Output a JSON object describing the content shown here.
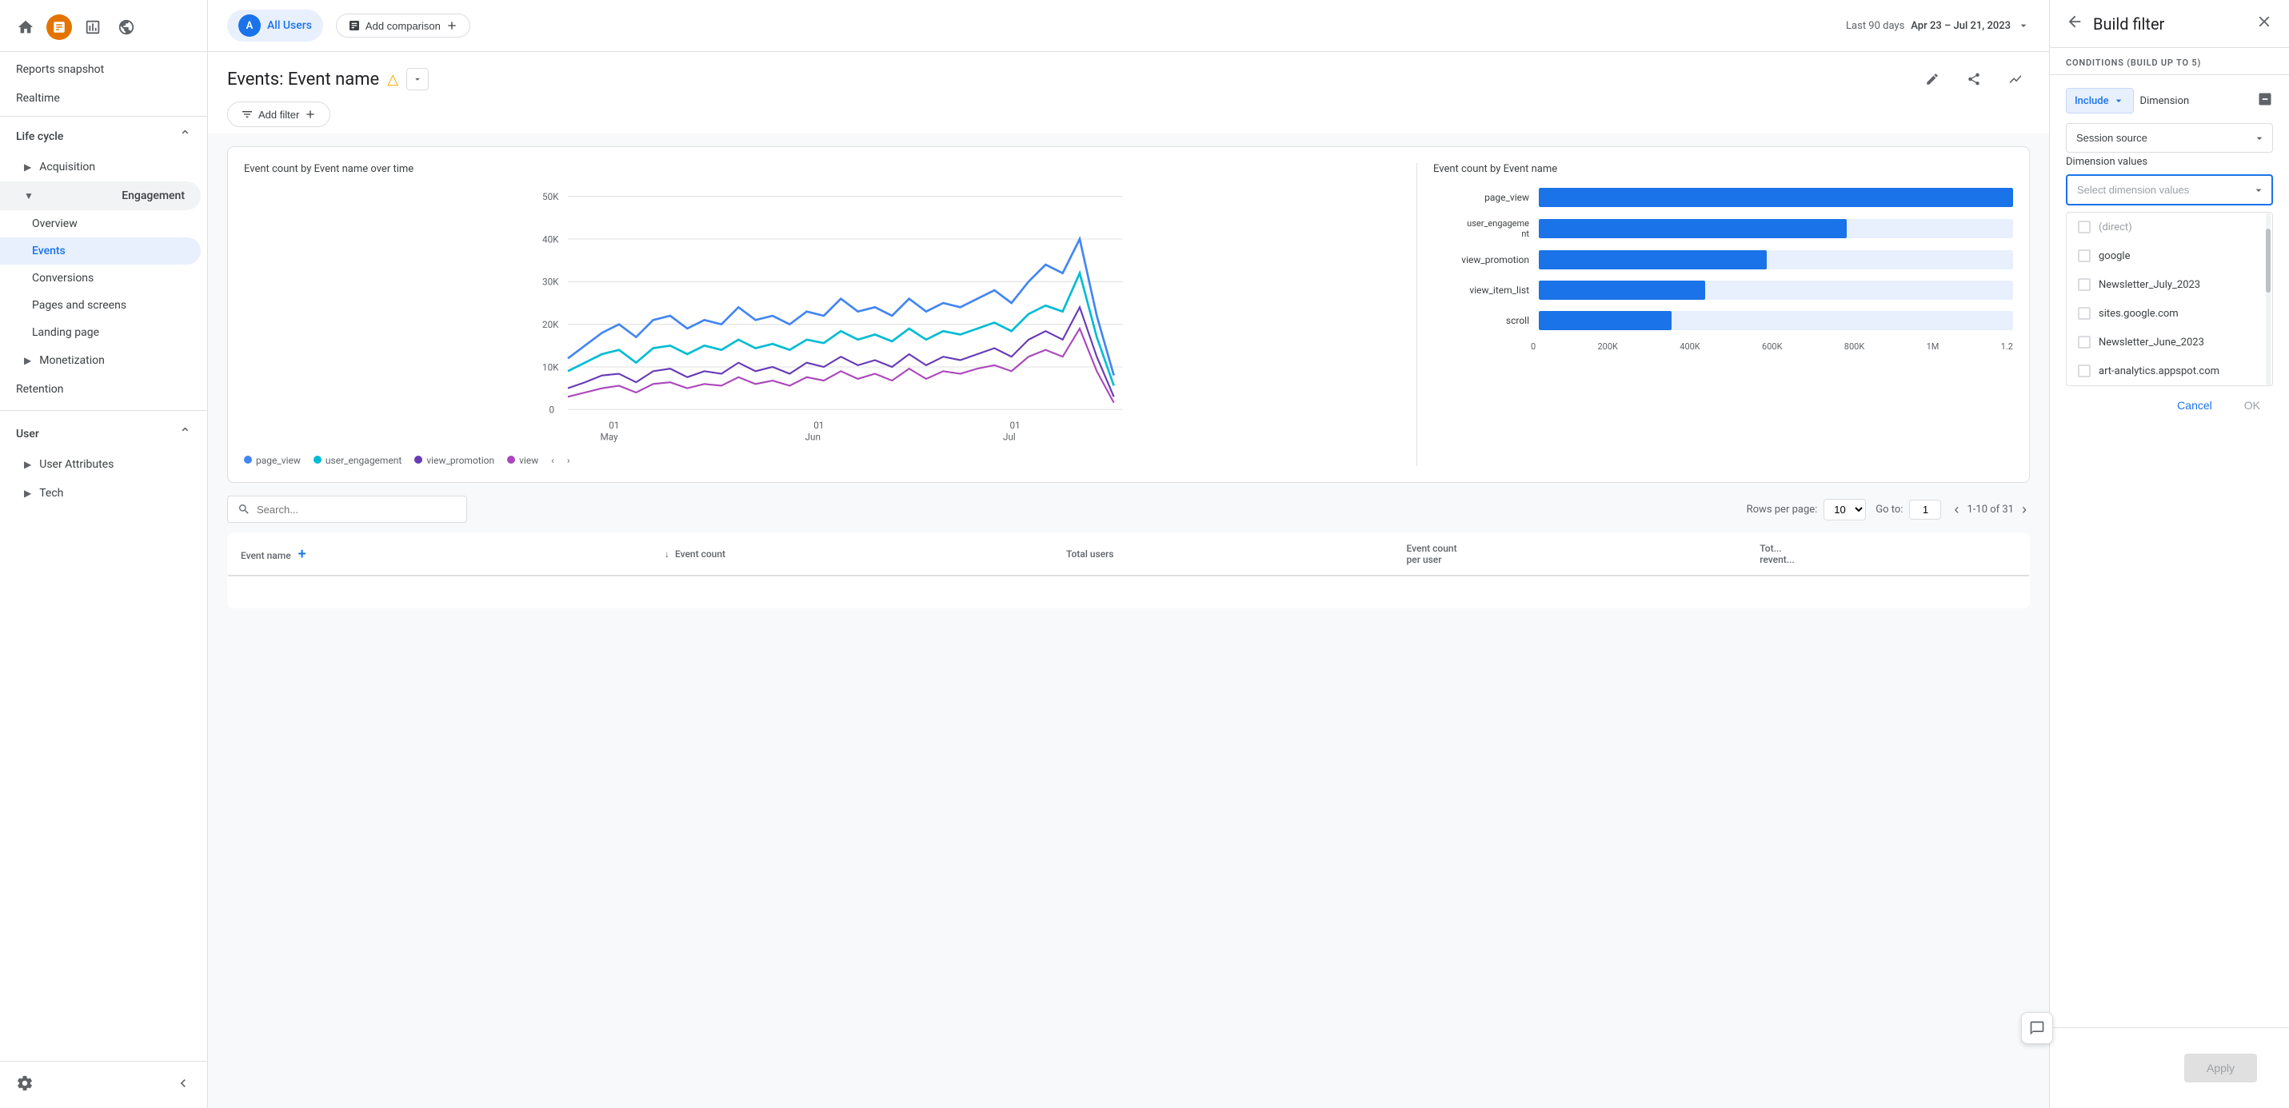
{
  "sidebar": {
    "reports_snapshot": "Reports snapshot",
    "realtime": "Realtime",
    "lifecycle_section": "Life cycle",
    "acquisition": "Acquisition",
    "engagement": "Engagement",
    "overview": "Overview",
    "events": "Events",
    "conversions": "Conversions",
    "pages_and_screens": "Pages and screens",
    "landing_page": "Landing page",
    "monetization": "Monetization",
    "retention": "Retention",
    "user_section": "User",
    "user_attributes": "User Attributes",
    "tech": "Tech"
  },
  "topbar": {
    "user_label": "All Users",
    "user_initial": "A",
    "add_comparison": "Add comparison",
    "date_prefix": "Last 90 days",
    "date_range": "Apr 23 – Jul 21, 2023"
  },
  "page": {
    "title": "Events: Event name",
    "add_filter": "Add filter"
  },
  "chart_left": {
    "title": "Event count by Event name over time",
    "y_labels": [
      "50K",
      "40K",
      "30K",
      "20K",
      "10K",
      "0"
    ],
    "x_labels": [
      "01 May",
      "01 Jun",
      "01 Jul"
    ],
    "legend": [
      {
        "label": "page_view",
        "color": "#4285f4"
      },
      {
        "label": "user_engagement",
        "color": "#34a853"
      },
      {
        "label": "view_promotion",
        "color": "#673ab7"
      },
      {
        "label": "view...",
        "color": "#ab47bc"
      }
    ]
  },
  "chart_right": {
    "title": "Event count by Event name",
    "bars": [
      {
        "label": "page_view",
        "value": 100
      },
      {
        "label": "user_engageme\nnt",
        "value": 65
      },
      {
        "label": "view_promotion",
        "value": 48
      },
      {
        "label": "view_item_list",
        "value": 35
      },
      {
        "label": "scroll",
        "value": 30
      }
    ],
    "x_labels": [
      "0",
      "200K",
      "400K",
      "600K",
      "800K",
      "1M",
      "1.2"
    ]
  },
  "table": {
    "search_placeholder": "Search...",
    "rows_per_page_label": "Rows per page:",
    "rows_per_page_value": "10",
    "goto_label": "Go to:",
    "goto_value": "1",
    "pagination": "1-10 of 31",
    "columns": [
      {
        "label": "Event name",
        "sortable": false
      },
      {
        "label": "↓ Event count",
        "sortable": true
      },
      {
        "label": "Total users",
        "sortable": true
      },
      {
        "label": "Event count per user",
        "sortable": true
      },
      {
        "label": "Tot... revent...",
        "sortable": true
      }
    ]
  },
  "filter_panel": {
    "title": "Build filter",
    "conditions_label": "CONDITIONS (BUILD UP TO 5)",
    "include_label": "Include",
    "dimension_label": "Dimension",
    "session_source_label": "Session source",
    "dimension_values_label": "Dimension values",
    "select_placeholder": "Select dimension values",
    "options": [
      {
        "label": "(direct)",
        "faded": true
      },
      {
        "label": "google",
        "faded": false
      },
      {
        "label": "Newsletter_July_2023",
        "faded": false
      },
      {
        "label": "sites.google.com",
        "faded": false
      },
      {
        "label": "Newsletter_June_2023",
        "faded": false
      },
      {
        "label": "art-analytics.appspot.com",
        "faded": false
      }
    ],
    "cancel_label": "Cancel",
    "ok_label": "OK",
    "apply_label": "Apply"
  }
}
